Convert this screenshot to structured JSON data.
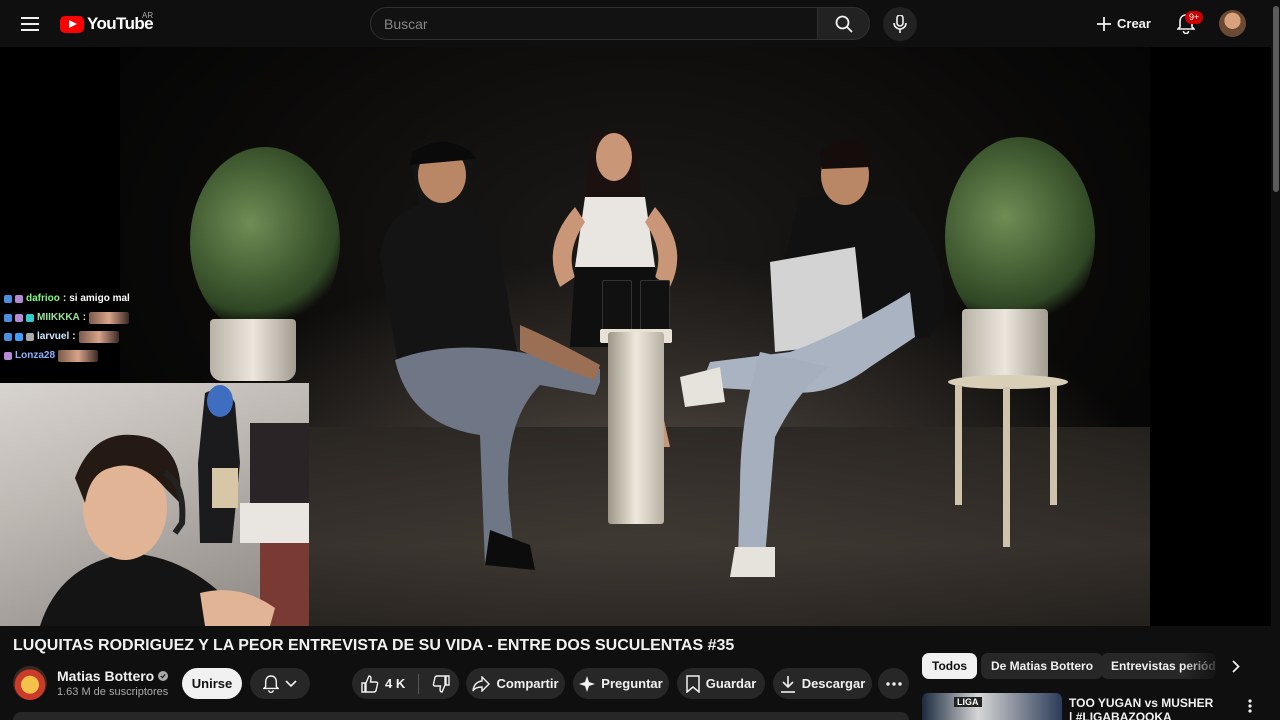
{
  "topbar": {
    "logo_text": "YouTube",
    "country_code": "AR",
    "search_placeholder": "Buscar",
    "create_label": "Crear",
    "notifications_badge": "9+"
  },
  "stream_chat": [
    {
      "user": "dafrioo",
      "message": "si amigo mal",
      "user_color": "#7cfc7c"
    },
    {
      "user": "MIIKKKA",
      "message": "",
      "user_color": "#9be39b"
    },
    {
      "user": "larvuel",
      "message": "",
      "user_color": "#cfe8ff"
    },
    {
      "user": "Lonza28",
      "message": "",
      "user_color": "#8ab4ff"
    }
  ],
  "video": {
    "title": "LUQUITAS RODRIGUEZ Y LA PEOR ENTREVISTA DE SU VIDA - ENTRE DOS SUCULENTAS #35",
    "channel_name": "Matias Bottero",
    "subscribers": "1.63 M de suscriptores",
    "join_label": "Unirse",
    "likes": "4 K",
    "share_label": "Compartir",
    "ask_label": "Preguntar",
    "save_label": "Guardar",
    "download_label": "Descargar"
  },
  "related": {
    "chips": [
      "Todos",
      "De Matias Bottero",
      "Entrevistas periódicas"
    ],
    "first_video_title": "TOO YUGAN vs MUSHER | #LIGABAZOOKA NACIONAL",
    "first_thumb_text": "LIGA"
  },
  "colors": {
    "background": "#0f0f0f",
    "pill": "#272727",
    "brand_red": "#ff0000",
    "badge_red": "#cc0000"
  }
}
